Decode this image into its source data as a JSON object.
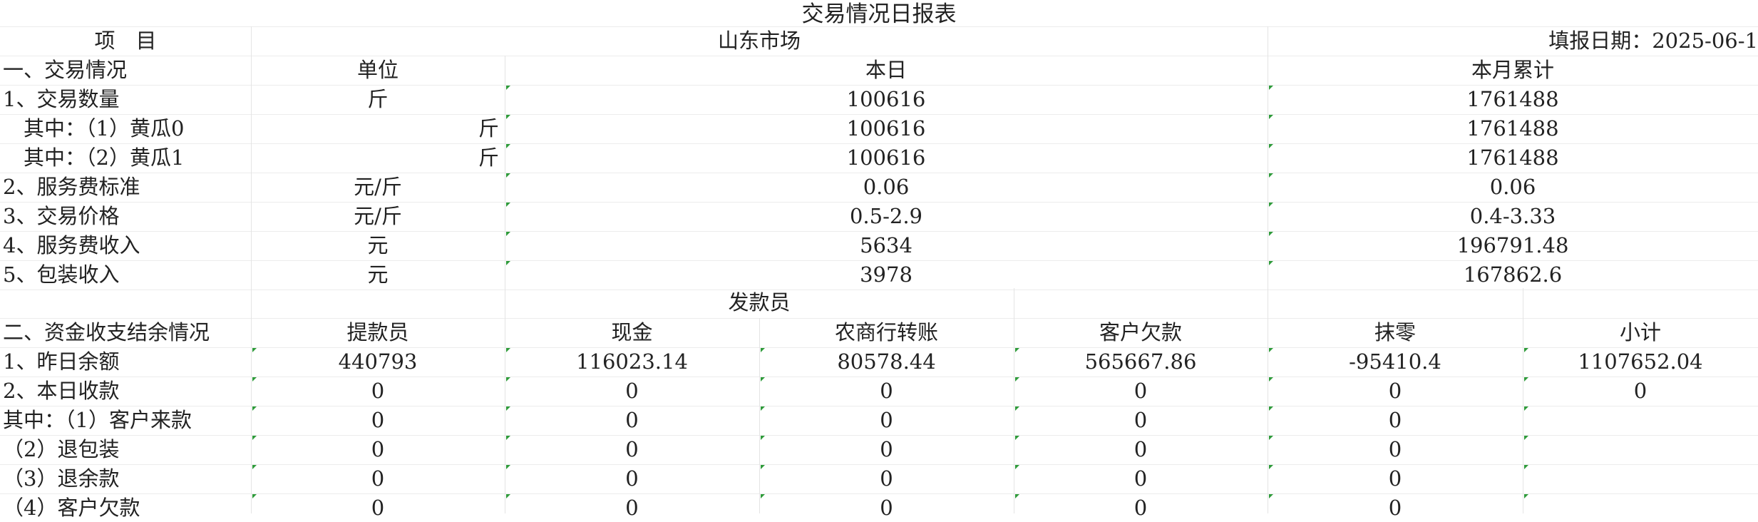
{
  "title": "交易情况日报表",
  "header": {
    "item_label": "项　目",
    "market": "山东市场",
    "fill_date": "填报日期：2025-06-1"
  },
  "section1": {
    "label": "一、交易情况",
    "col_unit": "单位",
    "col_today": "本日",
    "col_month": "本月累计",
    "rows": [
      {
        "label": "1、交易数量",
        "unit": "斤",
        "today": "100616",
        "month": "1761488"
      },
      {
        "label": "　其中：（1）黄瓜0",
        "unit": "斤",
        "today": "100616",
        "month": "1761488"
      },
      {
        "label": "　其中：（2）黄瓜1",
        "unit": "斤",
        "today": "100616",
        "month": "1761488"
      },
      {
        "label": "2、服务费标准",
        "unit": "元/斤",
        "today": "0.06",
        "month": "0.06"
      },
      {
        "label": "3、交易价格",
        "unit": "元/斤",
        "today": "0.5-2.9",
        "month": "0.4-3.33"
      },
      {
        "label": "4、服务费收入",
        "unit": "元",
        "today": "5634",
        "month": "196791.48"
      },
      {
        "label": "5、包装收入",
        "unit": "元",
        "today": "3978",
        "month": "167862.6"
      }
    ]
  },
  "section2": {
    "label": "二、资金收支结余情况",
    "col_withdraw": "提款员",
    "col_payer": "发款员",
    "col_cash": "现金",
    "col_bank": "农商行转账",
    "col_debt": "客户欠款",
    "col_rounding": "抹零",
    "col_subtotal": "小计",
    "rows": [
      {
        "label": "1、昨日余额",
        "values": [
          "440793",
          "116023.14",
          "80578.44",
          "565667.86",
          "-95410.4",
          "1107652.04"
        ]
      },
      {
        "label": "2、本日收款",
        "values": [
          "0",
          "0",
          "0",
          "0",
          "0",
          "0"
        ]
      },
      {
        "label": "其中：（1）客户来款",
        "values": [
          "0",
          "0",
          "0",
          "0",
          "0",
          ""
        ]
      },
      {
        "label": "（2）退包装",
        "values": [
          "0",
          "0",
          "0",
          "0",
          "0",
          ""
        ]
      },
      {
        "label": "（3）退余款",
        "values": [
          "0",
          "0",
          "0",
          "0",
          "0",
          ""
        ]
      },
      {
        "label": "（4）客户欠款",
        "values": [
          "0",
          "0",
          "0",
          "0",
          "0",
          ""
        ]
      }
    ]
  },
  "colors": {
    "grid": "#e4e4e4",
    "marker": "#2e9b3a",
    "text": "#222222"
  }
}
